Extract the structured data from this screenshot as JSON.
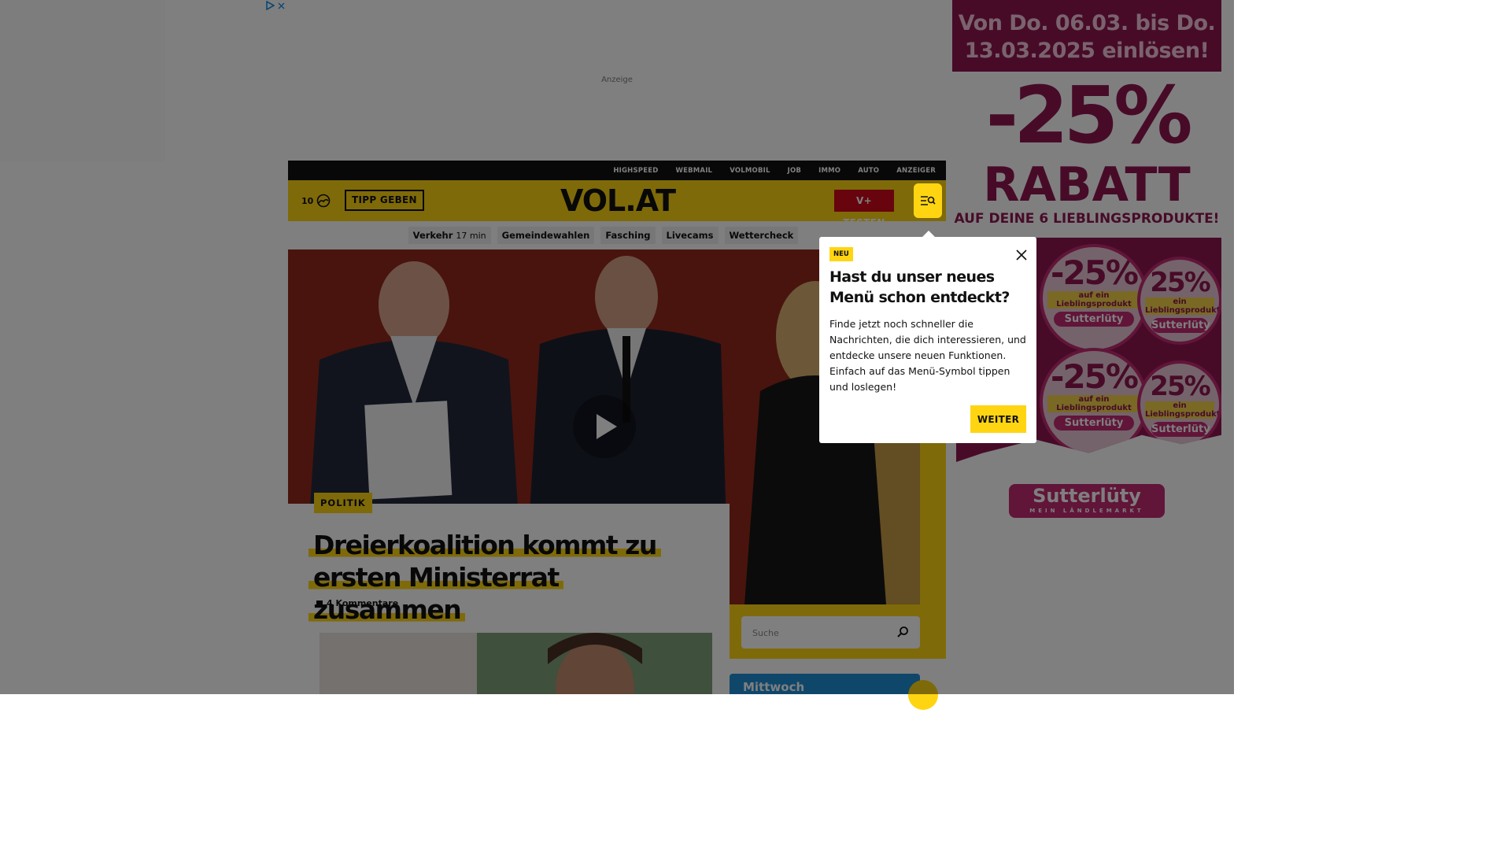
{
  "ads": {
    "top_label": "Anzeige",
    "right": {
      "dates": "Von Do. 06.03. bis Do. 13.03.2025 einlösen!",
      "discount": "-25%",
      "rabatt": "RABATT",
      "subline": "AUF DEINE 6 LIEBLINGSPRODUKTE!",
      "sticker_pct": "-25%",
      "sticker_pct_small": "25%",
      "sticker_text": "auf ein Lieblingsprodukt",
      "sticker_text_small": "ein Lieblingsprodukt",
      "sticker_brand": "Sutterlüty",
      "brand": "Sutterlüty",
      "brand_tagline": "MEIN LÄNDLEMARKT",
      "color": "#8e1651"
    }
  },
  "topbar": {
    "links": [
      "HIGHSPEED",
      "WEBMAIL",
      "VOLMOBIL",
      "JOB",
      "IMMO",
      "AUTO",
      "ANZEIGER"
    ]
  },
  "header": {
    "temperature": "10",
    "weather_icon": "cloud-sun-icon",
    "tipp_label": "TIPP GEBEN",
    "logo": "VOL.AT",
    "vplus_label": "V+ TESTEN",
    "menu_icon": "menu-search-icon",
    "brand_color": "#ffd512"
  },
  "tags": [
    {
      "label": "Verkehr",
      "extra": "17 min"
    },
    {
      "label": "Gemeindewahlen",
      "extra": ""
    },
    {
      "label": "Fasching",
      "extra": ""
    },
    {
      "label": "Livecams",
      "extra": ""
    },
    {
      "label": "Wettercheck",
      "extra": ""
    }
  ],
  "article": {
    "category": "POLITIK",
    "headline": "Dreierkoalition kommt zu ersten Ministerrat zusammen",
    "comments": "4 Kommentare"
  },
  "sidebar": {
    "search_placeholder": "Suche",
    "weather_day": "Mittwoch"
  },
  "popup": {
    "badge": "NEU",
    "title": "Hast du unser neues Menü schon entdeckt?",
    "body": "Finde jetzt noch schneller die Nachrichten, die dich interessieren, und entdecke unsere neuen Funktionen. Einfach auf das Menü-Symbol tippen und loslegen!",
    "button": "WEITER"
  }
}
